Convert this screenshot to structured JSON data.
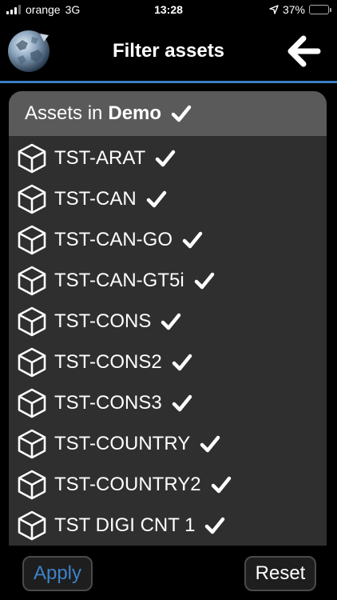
{
  "status_bar": {
    "carrier": "orange",
    "network": "3G",
    "time": "13:28",
    "battery": "37%",
    "battery_level": 0.37
  },
  "header": {
    "title": "Filter assets"
  },
  "panel": {
    "header_prefix": "Assets in",
    "header_bold": "Demo",
    "items": [
      {
        "label": "TST-ARAT",
        "checked": true
      },
      {
        "label": "TST-CAN",
        "checked": true
      },
      {
        "label": "TST-CAN-GO",
        "checked": true
      },
      {
        "label": "TST-CAN-GT5i",
        "checked": true
      },
      {
        "label": "TST-CONS",
        "checked": true
      },
      {
        "label": "TST-CONS2",
        "checked": true
      },
      {
        "label": "TST-CONS3",
        "checked": true
      },
      {
        "label": "TST-COUNTRY",
        "checked": true
      },
      {
        "label": "TST-COUNTRY2",
        "checked": true
      },
      {
        "label": "TST DIGI CNT 1",
        "checked": true
      }
    ]
  },
  "footer": {
    "apply_label": "Apply",
    "reset_label": "Reset"
  },
  "colors": {
    "accent": "#3d82c8",
    "battery": "#f2c521",
    "panel_bg": "#2f2f2f",
    "panel_header_bg": "#5a5a5a"
  },
  "icons": {
    "asset": "cube-icon",
    "selected": "checkmark-icon",
    "back": "arrow-left-icon",
    "logo": "globe-logo-icon"
  }
}
